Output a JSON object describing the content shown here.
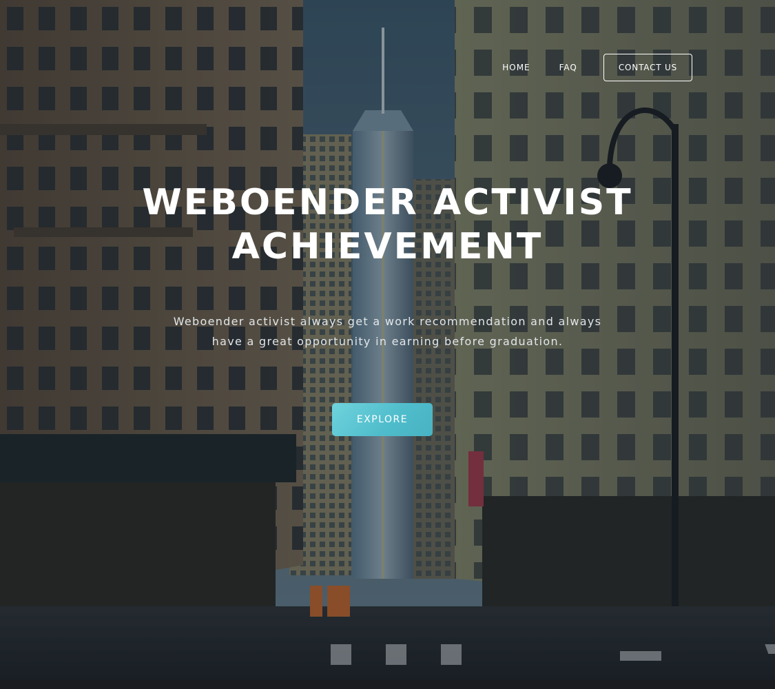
{
  "nav": {
    "items": [
      {
        "label": "HOME"
      },
      {
        "label": "FAQ"
      }
    ],
    "contact_label": "CONTACT US"
  },
  "hero": {
    "title_line1": "WEBOENDER ACTIVIST",
    "title_line2": "ACHIEVEMENT",
    "subtitle": "Weboender activist always get a work recommendation and always have a great opportunity in earning before graduation.",
    "cta_label": "EXPLORE",
    "background_image": "city-street-skyscraper-photo"
  },
  "colors": {
    "cta": "#5cc7d2",
    "text": "#ffffff",
    "overlay": "#1a2733"
  }
}
